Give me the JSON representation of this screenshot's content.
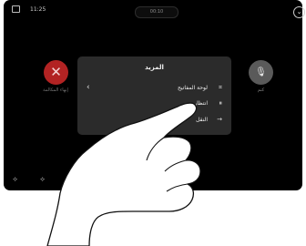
{
  "status": {
    "time": "11:25",
    "call_pill": "00:10"
  },
  "call": {
    "end_label": "إنهاء المكالمة",
    "mute_label": "كتم"
  },
  "sheet": {
    "title": "المزيد",
    "items": [
      {
        "label": "لوحة المفاتيح",
        "icon": "keypad-icon",
        "has_chevron": true
      },
      {
        "label": "انتظار",
        "icon": "hold-icon",
        "has_chevron": false
      },
      {
        "label": "النقل",
        "icon": "transfer-icon",
        "has_chevron": false
      }
    ]
  },
  "colors": {
    "end_call": "#b22323",
    "sheet_bg": "#2b2b2b",
    "screen_bg": "#000000"
  }
}
